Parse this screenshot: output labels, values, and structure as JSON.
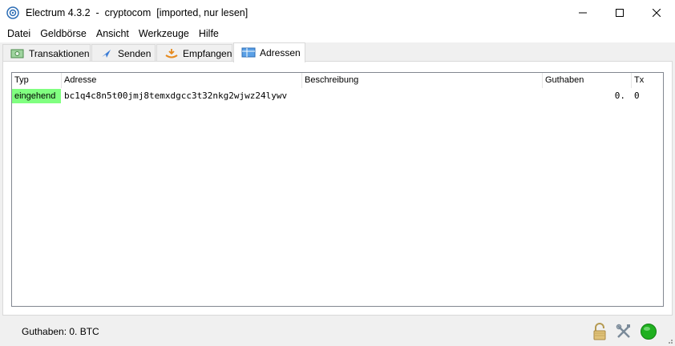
{
  "window": {
    "title": "Electrum 4.3.2  -  cryptocom  [imported, nur lesen]",
    "app_icon": "electrum-logo-icon",
    "controls": [
      "minimize-icon",
      "maximize-icon",
      "close-icon"
    ]
  },
  "menu": {
    "items": [
      "Datei",
      "Geldbörse",
      "Ansicht",
      "Werkzeuge",
      "Hilfe"
    ]
  },
  "tabs": [
    {
      "label": "Transaktionen",
      "icon": "transactions-icon",
      "active": false
    },
    {
      "label": "Senden",
      "icon": "send-icon",
      "active": false
    },
    {
      "label": "Empfangen",
      "icon": "receive-icon",
      "active": false
    },
    {
      "label": "Adressen",
      "icon": "addresses-icon",
      "active": true
    }
  ],
  "addresses_table": {
    "columns": [
      "Typ",
      "Adresse",
      "Beschreibung",
      "Guthaben",
      "Tx"
    ],
    "rows": [
      {
        "type": "eingehend",
        "address": "bc1q4c8n5t00jmj8temxdgcc3t32nkg2wjwz24lywv",
        "description": "",
        "balance": "0.",
        "tx": "0"
      }
    ],
    "type_color": "#80ff80"
  },
  "statusbar": {
    "balance_text": "Guthaben: 0. BTC",
    "icons": [
      "lock-icon",
      "tools-icon",
      "network-status-icon"
    ],
    "network_status_color": "#20b020"
  }
}
